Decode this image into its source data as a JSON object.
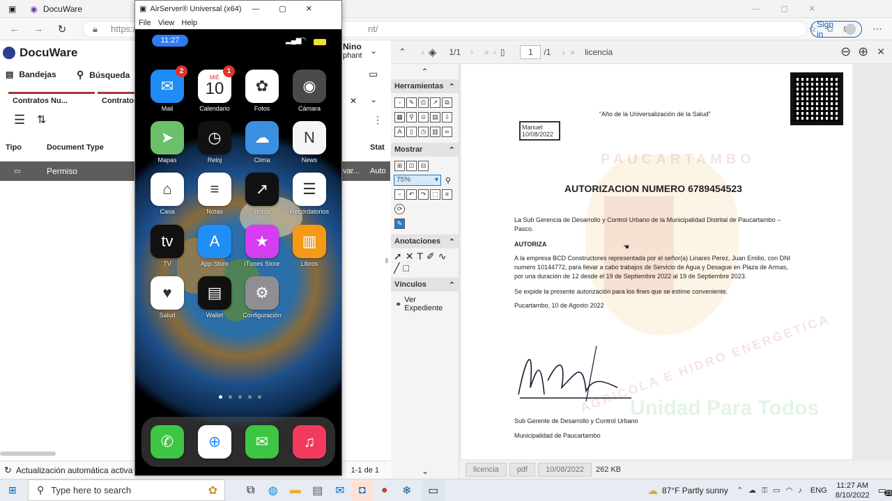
{
  "browser": {
    "tab_title": "DocuWare",
    "url_prefix": "https://",
    "url_suffix": "nt/",
    "signin_label": "Sign in"
  },
  "docuware": {
    "logo": "DocuWare",
    "menu": {
      "inbox": "Bandejas",
      "search": "Búsqueda"
    },
    "user_name": "Nino",
    "user_sub": "phant",
    "tabs": [
      "Contratos Nu...",
      "Contratos"
    ],
    "columns": {
      "type": "Tipo",
      "doctype": "Document Type",
      "status": "Stat"
    },
    "row": {
      "doctype": "Permiso",
      "mid": "var...",
      "status": "Auto"
    },
    "status_text": "Actualización automática activa",
    "count_text": "1-1 de 1"
  },
  "airserver": {
    "title": "AirServer® Universal (x64)",
    "menu": [
      "File",
      "View",
      "Help"
    ],
    "time": "11:27",
    "apps": [
      {
        "label": "Mail",
        "badge": "2",
        "color": "#1e8cf4",
        "icon": "envelope-icon",
        "glyph": "✉"
      },
      {
        "label": "Calendario",
        "badge": "1",
        "color": "#ffffff",
        "icon": "calendar-icon",
        "glyph": "10",
        "sub": "MIÉ"
      },
      {
        "label": "Fotos",
        "color": "#ffffff",
        "icon": "photos-icon",
        "glyph": "✿"
      },
      {
        "label": "Cámara",
        "color": "#4a4a4a",
        "icon": "camera-icon",
        "glyph": "◉"
      },
      {
        "label": "Mapas",
        "color": "#6cc06a",
        "icon": "map-icon",
        "glyph": "➤"
      },
      {
        "label": "Reloj",
        "color": "#111111",
        "icon": "clock-icon",
        "glyph": "◷"
      },
      {
        "label": "Clima",
        "color": "#3b8fe0",
        "icon": "weather-icon",
        "glyph": "☁"
      },
      {
        "label": "News",
        "color": "#f5f5f5",
        "icon": "news-icon",
        "glyph": "N"
      },
      {
        "label": "Casa",
        "color": "#ffffff",
        "icon": "home-icon",
        "glyph": "⌂"
      },
      {
        "label": "Notas",
        "color": "#ffffff",
        "icon": "notes-icon",
        "glyph": "≡"
      },
      {
        "label": "Bolsa",
        "color": "#111111",
        "icon": "stocks-icon",
        "glyph": "↗"
      },
      {
        "label": "Recordatorios",
        "color": "#ffffff",
        "icon": "reminders-icon",
        "glyph": "☰"
      },
      {
        "label": "TV",
        "color": "#111111",
        "icon": "tv-icon",
        "glyph": "tv"
      },
      {
        "label": "App Store",
        "color": "#1f8ef5",
        "icon": "appstore-icon",
        "glyph": "A"
      },
      {
        "label": "iTunes Store",
        "color": "#d43ef0",
        "icon": "itunes-icon",
        "glyph": "★"
      },
      {
        "label": "Libros",
        "color": "#f59a17",
        "icon": "books-icon",
        "glyph": "▥"
      },
      {
        "label": "Salud",
        "color": "#ffffff",
        "icon": "health-icon",
        "glyph": "♥"
      },
      {
        "label": "Wallet",
        "color": "#111111",
        "icon": "wallet-icon",
        "glyph": "▤"
      },
      {
        "label": "Configuración",
        "color": "#8e8e93",
        "icon": "settings-icon",
        "glyph": "⚙"
      }
    ],
    "dock": [
      {
        "color": "#3fc544",
        "icon": "phone-icon",
        "glyph": "✆"
      },
      {
        "color": "#ffffff",
        "icon": "safari-icon",
        "glyph": "⊕"
      },
      {
        "color": "#3fc544",
        "icon": "messages-icon",
        "glyph": "✉"
      },
      {
        "color": "#f23b5c",
        "icon": "music-icon",
        "glyph": "♫"
      }
    ]
  },
  "viewer": {
    "page_info": "1/1",
    "page_current": "1",
    "page_total": "/1",
    "doc_name": "licencia",
    "sections": {
      "tools": "Herramientas",
      "show": "Mostrar",
      "annotations": "Anotaciones",
      "links": "Vínculos"
    },
    "zoom": "75%",
    "link_label": "Ver Expediente",
    "footer_tags": [
      "licencia",
      "pdf",
      "10/08/2022"
    ],
    "footer_size": "262 KB"
  },
  "document": {
    "motto": "“Año de la Universalización de la Salud”",
    "stamp_line1": "Manuel",
    "stamp_line2": "10/08/2022",
    "title": "AUTORIZACION NUMERO 6789454523",
    "para1": "La Sub Gerencia de Desarrollo y Control Urbano de la Municipalidad Distrital de Paucartambo – Pasco.",
    "authorizes": "AUTORIZA",
    "para2": "A la empresa BCD Constructores representada por el señor(a) Linares Perez, Juan Emilio, con DNI numero 10144772, para llevar a cabo trabajos de Servicio de Agua y Desague en Plaza de Armas, por una duración de 12 desde el 19 de Septiembre 2022 al 19 de Septiembre 2023.",
    "para3": "Se expide la presente autorización para los fines que se estime conveniente.",
    "place_date": "Pucartambo, 10 de Agosto 2022",
    "sign_role": "Sub Gerente de Desarrollo y Control Urbano",
    "sign_org": "Municipalidad de Paucartambo",
    "watermark_top": "PAUCARTAMBO",
    "watermark_bottom": "AGRICOLA E HIDRO ENERGETICA",
    "watermark_slogan": "Unidad Para Todos"
  },
  "taskbar": {
    "search_placeholder": "Type here to search",
    "weather": "87°F  Partly sunny",
    "lang": "ENG",
    "time": "11:27 AM",
    "date": "8/10/2022",
    "notif_count": "23"
  }
}
